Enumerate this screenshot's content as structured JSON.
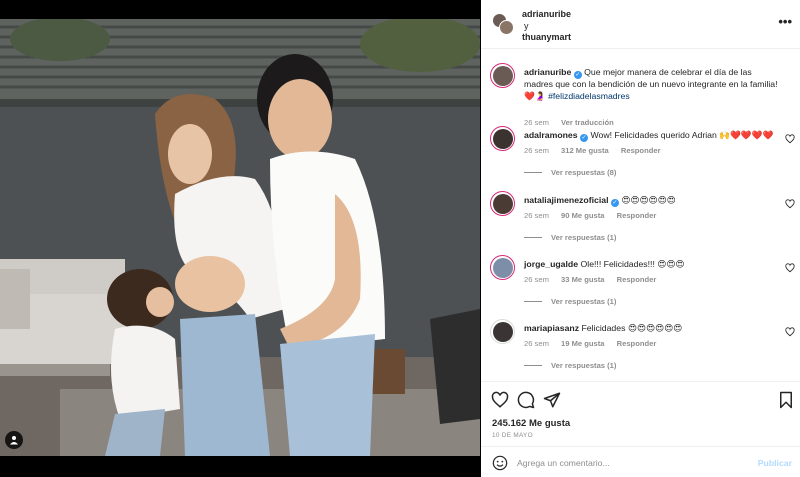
{
  "post": {
    "author": "adrianuribe",
    "connector": "y",
    "coauthor": "thuanymart"
  },
  "caption": {
    "user": "adrianuribe",
    "text": "Que mejor manera de celebrar el día de las madres que con la bendición de un nuevo integrante en la familia! ❤️🤰 ",
    "hashtag": "#felizdiadelasmadres",
    "time": "26 sem",
    "translate": "Ver traducción"
  },
  "comments": [
    {
      "user": "adalramones",
      "verified": true,
      "text": "Wow! Felicidades querido Adrian 🙌❤️❤️❤️❤️",
      "time": "26 sem",
      "likes": "312 Me gusta",
      "reply": "Responder",
      "replies": "Ver respuestas (8)"
    },
    {
      "user": "nataliajimenezoficial",
      "verified": true,
      "text": "😍😍😍😍😍😍",
      "time": "26 sem",
      "likes": "90 Me gusta",
      "reply": "Responder",
      "replies": "Ver respuestas (1)"
    },
    {
      "user": "jorge_ugalde",
      "verified": false,
      "text": "Ole!!! Felicidades!!! 😍😍😍",
      "time": "26 sem",
      "likes": "33 Me gusta",
      "reply": "Responder",
      "replies": "Ver respuestas (1)"
    },
    {
      "user": "mariapiasanz",
      "verified": false,
      "text": "Felicidades 😍😍😍😍😍😍",
      "time": "26 sem",
      "likes": "19 Me gusta",
      "reply": "Responder",
      "replies": "Ver respuestas (1)"
    }
  ],
  "stats": {
    "likes": "245.162 Me gusta",
    "date": "10 DE MAYO"
  },
  "add_comment": {
    "placeholder": "Agrega un comentario...",
    "publish": "Publicar"
  },
  "icons": {
    "more": "more-options-icon",
    "like": "heart-icon",
    "comment": "comment-icon",
    "share": "share-icon",
    "save": "bookmark-icon",
    "emoji": "emoji-icon",
    "tag": "user-tag-icon",
    "verified": "verified-badge-icon"
  },
  "colors": {
    "link": "#00376b",
    "verified": "#3897f0",
    "muted": "#8e8e8e",
    "publish_disabled": "#b3dbff"
  }
}
